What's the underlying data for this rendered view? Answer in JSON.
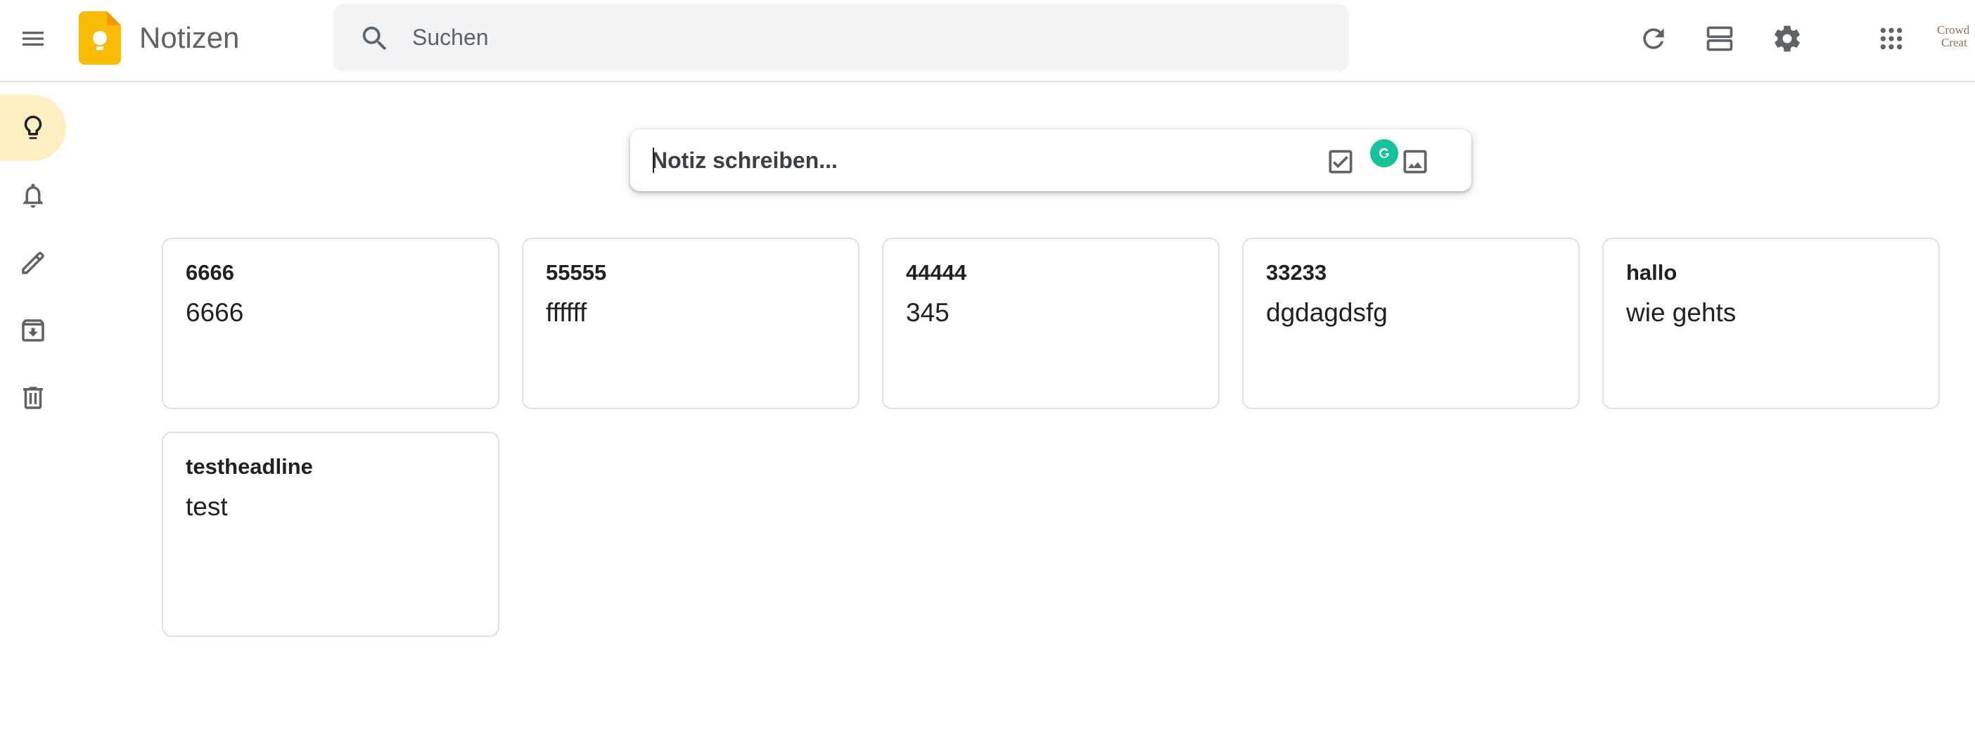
{
  "header": {
    "app_title": "Notizen",
    "search": {
      "placeholder": "Suchen",
      "value": ""
    },
    "account_logo": {
      "line1": "Crowd",
      "line2": "Creat"
    },
    "icons": {
      "menu": "hamburger-menu-icon",
      "logo": "keep-lightbulb-logo",
      "search": "search-icon",
      "refresh": "refresh-icon",
      "view": "list-view-icon",
      "settings": "gear-icon",
      "apps": "apps-grid-icon"
    }
  },
  "sidebar": {
    "items": [
      {
        "icon": "lightbulb-icon",
        "active": true
      },
      {
        "icon": "bell-icon",
        "active": false
      },
      {
        "icon": "pencil-icon",
        "active": false
      },
      {
        "icon": "archive-icon",
        "active": false
      },
      {
        "icon": "trash-icon",
        "active": false
      }
    ]
  },
  "composer": {
    "placeholder": "Notiz schreiben...",
    "value": "",
    "icons": [
      "checkbox-icon",
      "grammarly-icon",
      "image-icon"
    ]
  },
  "notes": [
    {
      "title": "6666",
      "body": "6666"
    },
    {
      "title": "55555",
      "body": "ffffff"
    },
    {
      "title": "44444",
      "body": "345"
    },
    {
      "title": "33233",
      "body": "dgdagdsfg"
    },
    {
      "title": "hallo",
      "body": "wie gehts"
    },
    {
      "title": "testheadline",
      "body": "test"
    }
  ],
  "colors": {
    "active_nav": "#feefc3",
    "logo_yellow": "#fbbc04",
    "icon_gray": "#5f6368",
    "search_bg": "#f1f3f4",
    "grammarly_green": "#15c39a"
  }
}
